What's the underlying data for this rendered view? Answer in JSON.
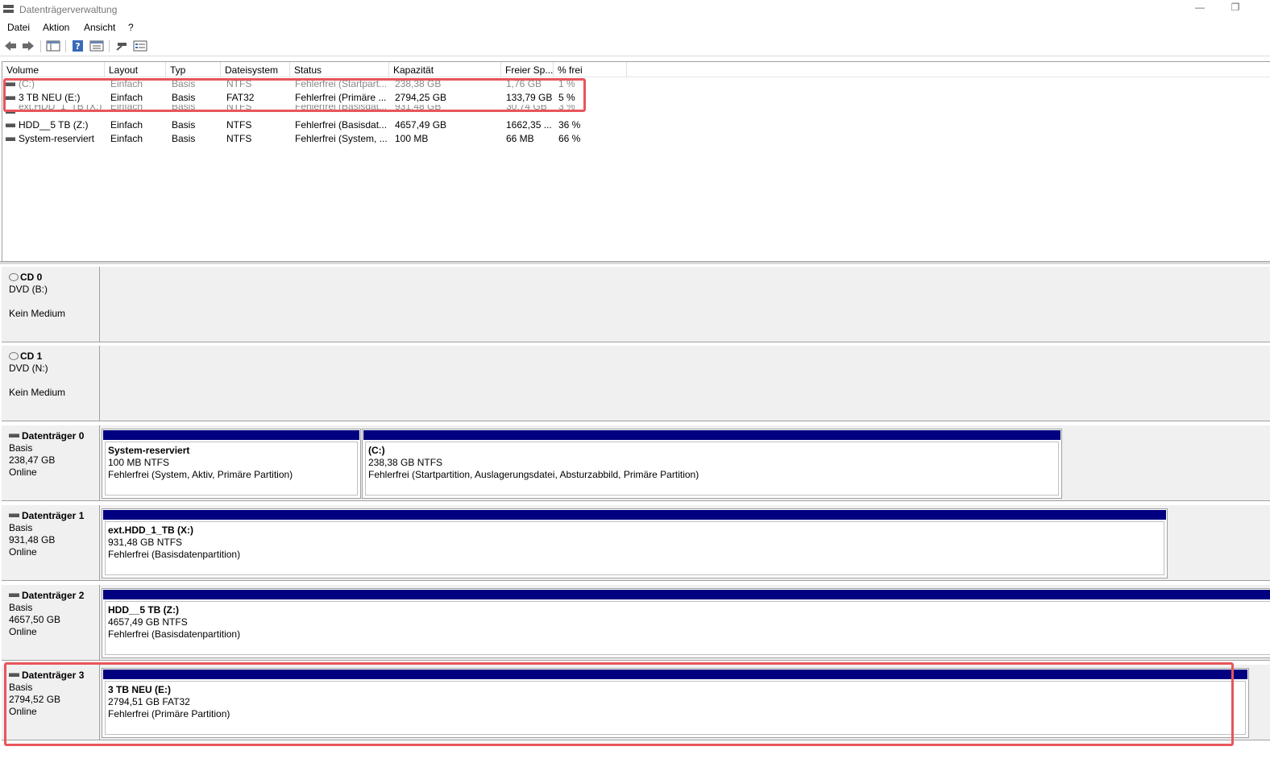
{
  "window": {
    "title": "Datenträgerverwaltung",
    "minimize": "—",
    "restore": "❐"
  },
  "menu": [
    "Datei",
    "Aktion",
    "Ansicht",
    "?"
  ],
  "columns": [
    "Volume",
    "Layout",
    "Typ",
    "Dateisystem",
    "Status",
    "Kapazität",
    "Freier Sp...",
    "% frei"
  ],
  "volumes": [
    {
      "volume": "(C:)",
      "layout": "Einfach",
      "typ": "Basis",
      "fs": "NTFS",
      "status": "Fehlerfrei (Startpart...",
      "cap": "238,38 GB",
      "free": "1,76 GB",
      "pct": "1 %"
    },
    {
      "volume": "3 TB  NEU (E:)",
      "layout": "Einfach",
      "typ": "Basis",
      "fs": "FAT32",
      "status": "Fehlerfrei (Primäre ...",
      "cap": "2794,25 GB",
      "free": "133,79 GB",
      "pct": "5 %"
    },
    {
      "volume": "ext.HDD_1_TB (X:)",
      "layout": "Einfach",
      "typ": "Basis",
      "fs": "NTFS",
      "status": "Fehlerfrei (Basisdat...",
      "cap": "931,48 GB",
      "free": "30,74 GB",
      "pct": "3 %"
    },
    {
      "volume": "HDD__5 TB (Z:)",
      "layout": "Einfach",
      "typ": "Basis",
      "fs": "NTFS",
      "status": "Fehlerfrei (Basisdat...",
      "cap": "4657,49 GB",
      "free": "1662,35 ...",
      "pct": "36 %"
    },
    {
      "volume": "System-reserviert",
      "layout": "Einfach",
      "typ": "Basis",
      "fs": "NTFS",
      "status": "Fehlerfrei (System, ...",
      "cap": "100 MB",
      "free": "66 MB",
      "pct": "66 %"
    }
  ],
  "disks": [
    {
      "name": "CD 0",
      "line1": "DVD (B:)",
      "line2": "",
      "line3": "Kein Medium",
      "partitions": []
    },
    {
      "name": "CD 1",
      "line1": "DVD (N:)",
      "line2": "",
      "line3": "Kein Medium",
      "partitions": []
    },
    {
      "name": "Datenträger 0",
      "line1": "Basis",
      "line2": "238,47 GB",
      "line3": "Online",
      "partitions": [
        {
          "title": "System-reserviert",
          "size": "100 MB NTFS",
          "status": "Fehlerfrei (System, Aktiv, Primäre Partition)"
        },
        {
          "title": " (C:)",
          "size": "238,38 GB NTFS",
          "status": "Fehlerfrei (Startpartition, Auslagerungsdatei, Absturzabbild, Primäre Partition)"
        }
      ]
    },
    {
      "name": "Datenträger 1",
      "line1": "Basis",
      "line2": "931,48 GB",
      "line3": "Online",
      "partitions": [
        {
          "title": "ext.HDD_1_TB  (X:)",
          "size": "931,48 GB NTFS",
          "status": "Fehlerfrei (Basisdatenpartition)"
        }
      ]
    },
    {
      "name": "Datenträger 2",
      "line1": "Basis",
      "line2": "4657,50 GB",
      "line3": "Online",
      "partitions": [
        {
          "title": "HDD__5 TB  (Z:)",
          "size": "4657,49 GB NTFS",
          "status": "Fehlerfrei (Basisdatenpartition)"
        }
      ]
    },
    {
      "name": "Datenträger 3",
      "line1": "Basis",
      "line2": "2794,52 GB",
      "line3": "Online",
      "partitions": [
        {
          "title": "3 TB  NEU  (E:)",
          "size": "2794,51 GB FAT32",
          "status": "Fehlerfrei (Primäre Partition)"
        }
      ]
    }
  ],
  "colors": {
    "partition_bar": "#000080",
    "highlight": "#e8555b"
  }
}
